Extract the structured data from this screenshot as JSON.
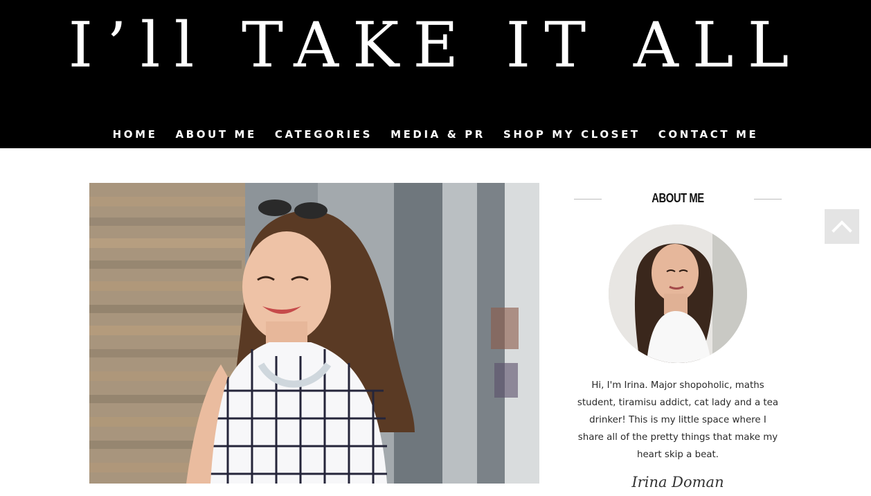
{
  "header": {
    "site_title": "I’ll TAKE IT ALL"
  },
  "nav": {
    "items": [
      {
        "label": "HOME"
      },
      {
        "label": "ABOUT ME"
      },
      {
        "label": "CATEGORIES"
      },
      {
        "label": "MEDIA & PR"
      },
      {
        "label": "SHOP MY CLOSET"
      },
      {
        "label": "CONTACT ME"
      }
    ]
  },
  "hero": {
    "image_subject": "woman-in-checked-blouse-photo"
  },
  "sidebar": {
    "widget_title": "ABOUT ME",
    "avatar_subject": "profile-photo",
    "bio": "Hi, I'm Irina. Major shopoholic, maths student, tiramisu addict, cat lady and a tea drinker! This is my little space where I share all of the pretty things that make my heart skip a beat.",
    "signature": "Irina Doman"
  },
  "controls": {
    "scroll_top_icon": "chevron-up-icon"
  },
  "colors": {
    "header_bg": "#000000",
    "header_text": "#ffffff",
    "page_bg": "#ffffff",
    "scroll_button_bg": "#e4e4e4"
  }
}
